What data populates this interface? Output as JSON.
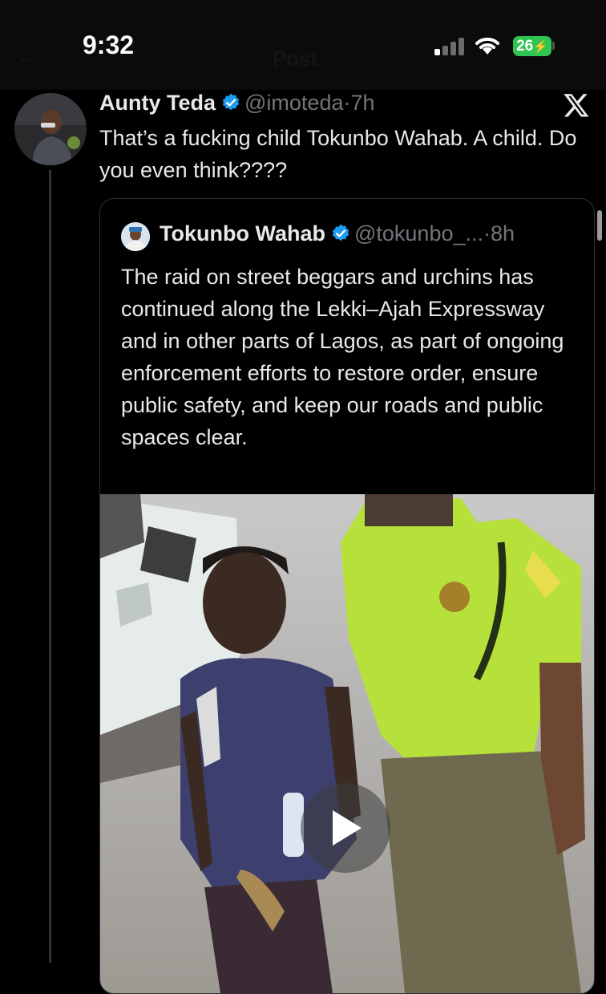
{
  "status_bar": {
    "time": "9:32",
    "battery": "26",
    "icons": [
      "signal-icon",
      "wifi-icon",
      "battery-charging-icon"
    ]
  },
  "header": {
    "title": "Post",
    "back_icon": "back-arrow-icon"
  },
  "tweet": {
    "author_name": "Aunty Teda",
    "handle": "@imoteda",
    "separator": "·",
    "time": "7h",
    "text": "That’s a fucking child Tokunbo Wahab. A child. Do you even think????",
    "icons": [
      "verified-badge-icon",
      "x-logo-icon"
    ]
  },
  "quote": {
    "author_name": "Tokunbo Wahab",
    "handle": "@tokunbo_...",
    "separator": "·",
    "time": "8h",
    "text": "The raid on street beggars and urchins has continued along the Lekki–Ajah Expressway and in other parts of Lagos, as part of ongoing enforcement efforts to restore order, ensure public safety, and keep our roads and public spaces clear.",
    "media": {
      "type": "video",
      "icon": "play-icon"
    }
  },
  "colors": {
    "background": "#000000",
    "text": "#e7e9ea",
    "secondary_text": "#71767b",
    "verified_blue": "#1d9bf0",
    "border": "#2f3336",
    "battery_green": "#30c451"
  }
}
